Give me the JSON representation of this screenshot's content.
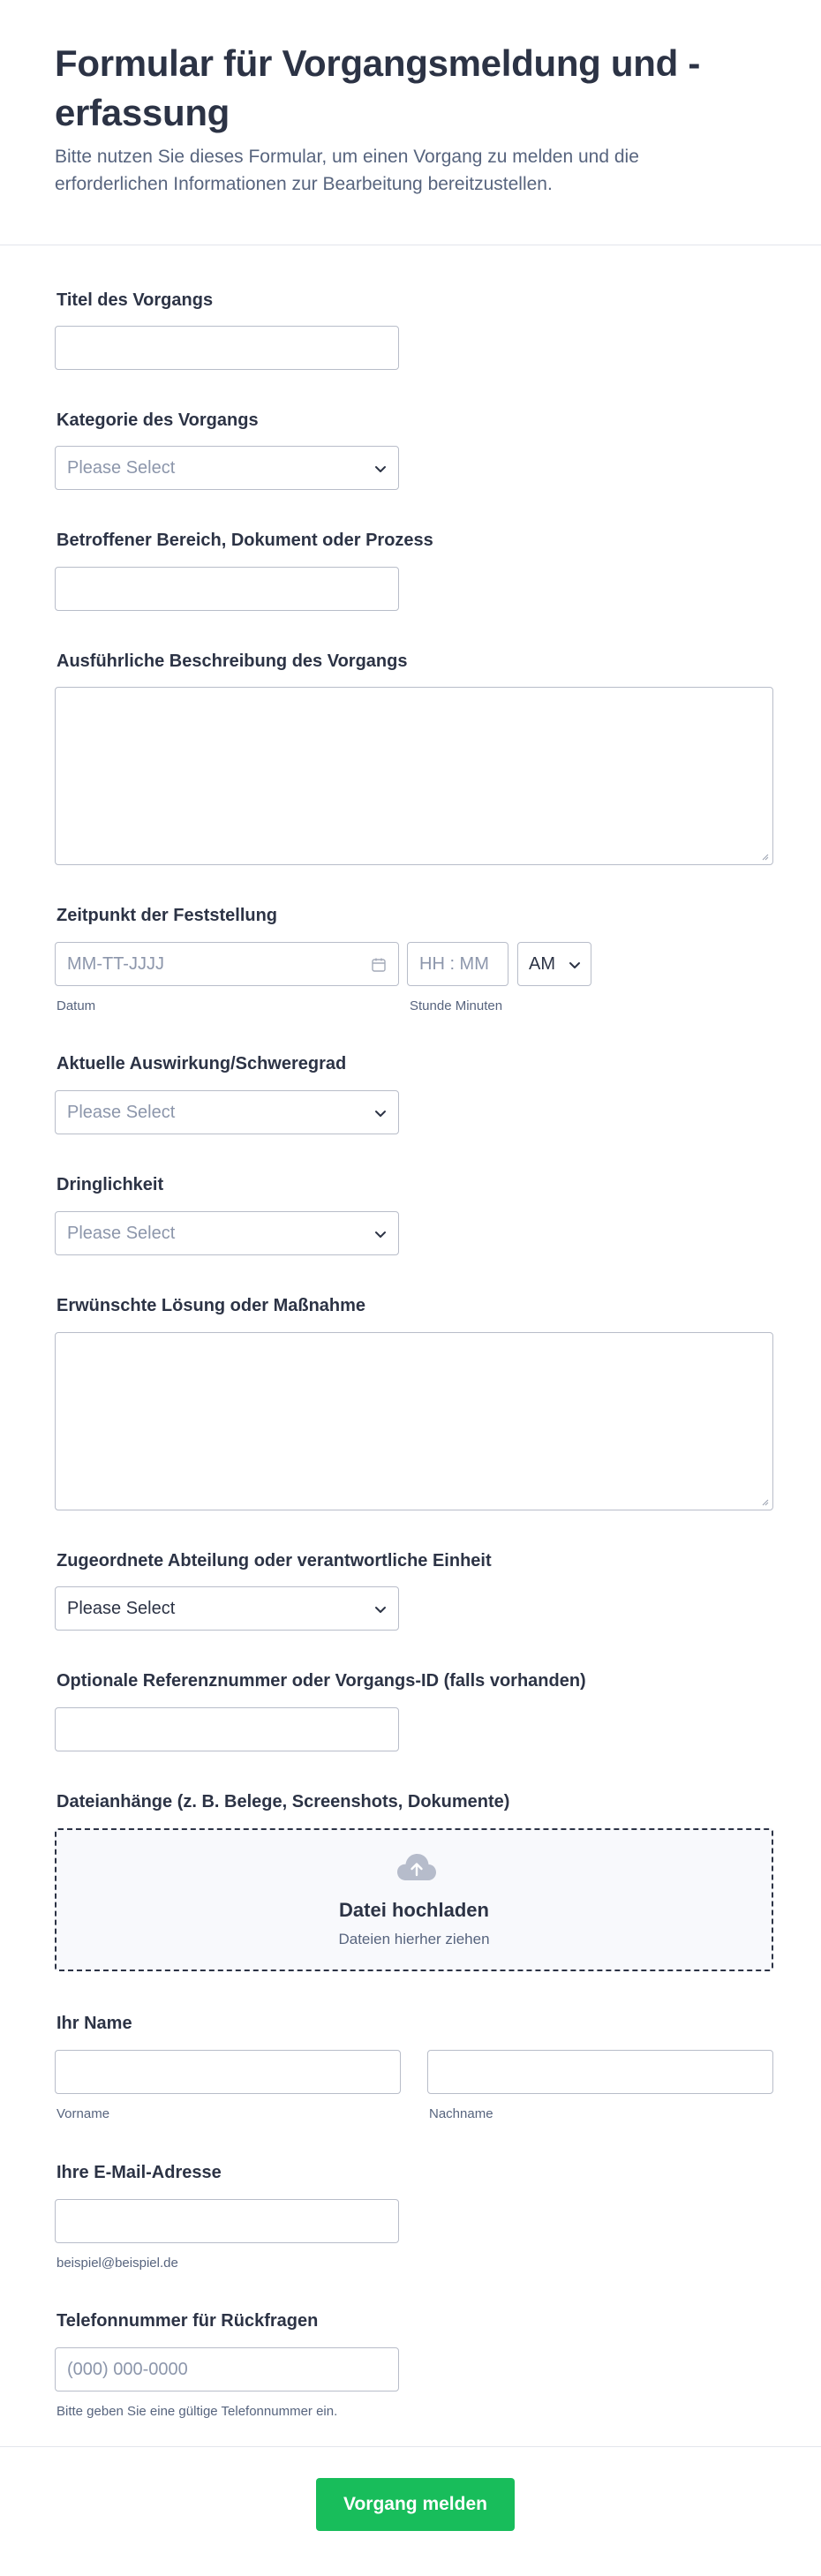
{
  "header": {
    "title": "Formular für Vorgangsmeldung und -erfassung",
    "subtitle": "Bitte nutzen Sie dieses Formular, um einen Vorgang zu melden und die erforderlichen Informationen zur Bearbeitung bereitzustellen."
  },
  "fields": {
    "titel": {
      "label": "Titel des Vorgangs",
      "value": ""
    },
    "kategorie": {
      "label": "Kategorie des Vorgangs",
      "placeholder": "Please Select"
    },
    "bereich": {
      "label": "Betroffener Bereich, Dokument oder Prozess",
      "value": ""
    },
    "beschreibung": {
      "label": "Ausführliche Beschreibung des Vorgangs",
      "value": ""
    },
    "zeitpunkt": {
      "label": "Zeitpunkt der Feststellung",
      "date_placeholder": "MM-TT-JJJJ",
      "date_sublabel": "Datum",
      "time_placeholder": "HH : MM",
      "time_sublabel": "Stunde Minuten",
      "ampm": "AM"
    },
    "auswirkung": {
      "label": "Aktuelle Auswirkung/Schweregrad",
      "placeholder": "Please Select"
    },
    "dringlichkeit": {
      "label": "Dringlichkeit",
      "placeholder": "Please Select"
    },
    "loesung": {
      "label": "Erwünschte Lösung oder Maßnahme",
      "value": ""
    },
    "abteilung": {
      "label": "Zugeordnete Abteilung oder verantwortliche Einheit",
      "value": "Please Select"
    },
    "referenz": {
      "label": "Optionale Referenznummer oder Vorgangs-ID (falls vorhanden)",
      "value": ""
    },
    "anhaenge": {
      "label": "Dateianhänge (z. B. Belege, Screenshots, Dokumente)",
      "upload_title": "Datei hochladen",
      "upload_hint": "Dateien hierher ziehen"
    },
    "name": {
      "label": "Ihr Name",
      "first_sublabel": "Vorname",
      "last_sublabel": "Nachname"
    },
    "email": {
      "label": "Ihre E-Mail-Adresse",
      "sublabel": "beispiel@beispiel.de"
    },
    "telefon": {
      "label": "Telefonnummer für Rückfragen",
      "placeholder": "(000) 000-0000",
      "sublabel": "Bitte geben Sie eine gültige Telefonnummer ein."
    }
  },
  "submit": {
    "label": "Vorgang melden"
  },
  "icons": {
    "select": "chevron-down-icon",
    "date": "calendar-icon",
    "upload": "cloud-upload-icon",
    "textarea": "resize-grip-icon"
  },
  "colors": {
    "accent": "#18bd5b",
    "text": "#2c3345",
    "muted": "#8c96ab",
    "border": "#b8bdc9"
  }
}
